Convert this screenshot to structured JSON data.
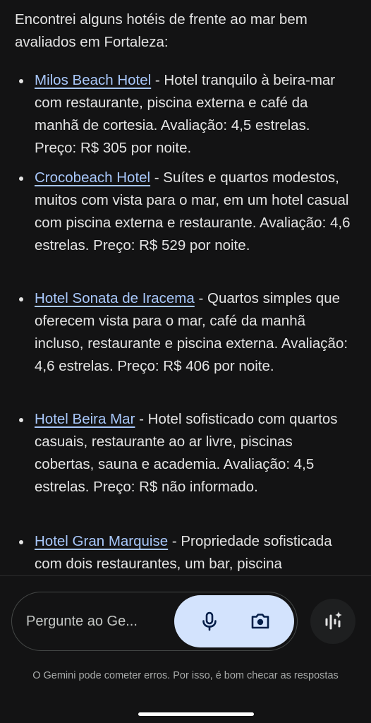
{
  "response": {
    "intro": "Encontrei alguns hotéis de frente ao mar bem avaliados em Fortaleza:",
    "hotels": [
      {
        "name": "Milos Beach Hotel",
        "description": " - Hotel tranquilo à beira-mar com restaurante, piscina externa e café da manhã de cortesia. Avaliação: 4,5 estrelas. Preço: R$ 305 por noite."
      },
      {
        "name": "Crocobeach Hotel",
        "description": " - Suítes e quartos modestos, muitos com vista para o mar, em um hotel casual com piscina externa e restaurante. Avaliação: 4,6 estrelas. Preço: R$ 529 por noite."
      },
      {
        "name": "Hotel Sonata de Iracema",
        "description": " - Quartos simples que oferecem vista para o mar, café da manhã incluso, restaurante e piscina externa. Avaliação: 4,6 estrelas. Preço: R$ 406 por noite."
      },
      {
        "name": "Hotel Beira Mar",
        "description": " - Hotel sofisticado com quartos casuais, restaurante ao ar livre, piscinas cobertas, sauna e academia. Avaliação: 4,5 estrelas. Preço: R$ não informado."
      },
      {
        "name": "Hotel Gran Marquise",
        "description": " - Propriedade sofisticada com dois restaurantes, um bar, piscina"
      }
    ]
  },
  "input_bar": {
    "placeholder": "Pergunte ao Ge...",
    "mic_icon": "microphone-icon",
    "camera_icon": "camera-icon",
    "live_icon": "gemini-live-icon"
  },
  "footer": {
    "disclaimer": "O Gemini pode cometer erros. Por isso, é bom checar as respostas"
  },
  "colors": {
    "background": "#131314",
    "text": "#e3e3e3",
    "link": "#a8c7fa",
    "pill": "#d3e3fd",
    "icon_dark": "#041e49"
  }
}
